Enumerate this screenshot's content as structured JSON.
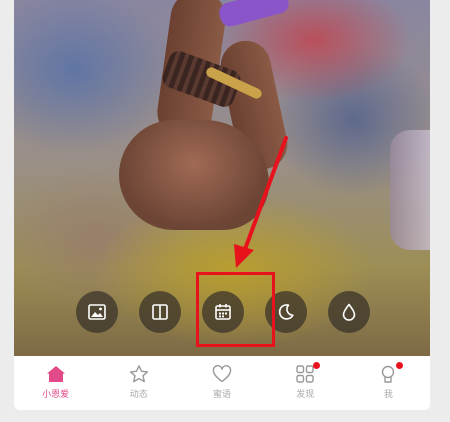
{
  "toolbar": {
    "buttons": [
      {
        "name": "image-icon"
      },
      {
        "name": "columns-icon"
      },
      {
        "name": "calendar-icon",
        "highlighted": true
      },
      {
        "name": "moon-icon"
      },
      {
        "name": "drop-icon"
      }
    ]
  },
  "tabbar": {
    "tabs": [
      {
        "label": "小恩爱",
        "icon": "home-icon",
        "active": true,
        "badge": false
      },
      {
        "label": "动态",
        "icon": "star-icon",
        "active": false,
        "badge": false
      },
      {
        "label": "蜜语",
        "icon": "heart-icon",
        "active": false,
        "badge": false
      },
      {
        "label": "发现",
        "icon": "grid-icon",
        "active": false,
        "badge": true
      },
      {
        "label": "我",
        "icon": "profile-icon",
        "active": false,
        "badge": true
      }
    ]
  },
  "colors": {
    "accent": "#e24a8a",
    "highlight": "#e8121c",
    "inactive": "#aaaaaa"
  }
}
